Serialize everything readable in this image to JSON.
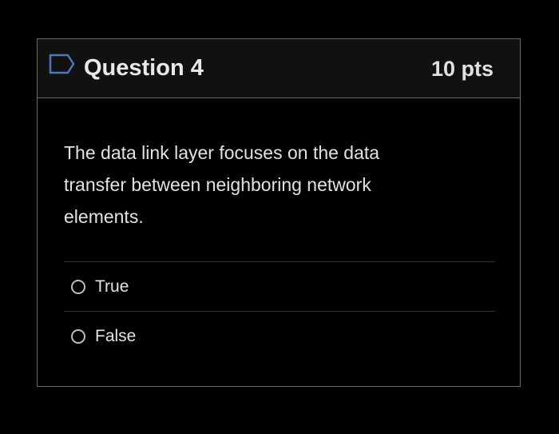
{
  "question": {
    "icon": "flag-icon",
    "title": "Question 4",
    "points": "10 pts",
    "text": "The data link layer focuses on the data transfer between neighboring network elements."
  },
  "answers": [
    {
      "label": "True",
      "selected": false
    },
    {
      "label": "False",
      "selected": false
    }
  ],
  "colors": {
    "background": "#000000",
    "header_background": "#111111",
    "border": "#6a6a6a",
    "flag_stroke": "#4a78b8",
    "text": "#e2e2e2"
  }
}
